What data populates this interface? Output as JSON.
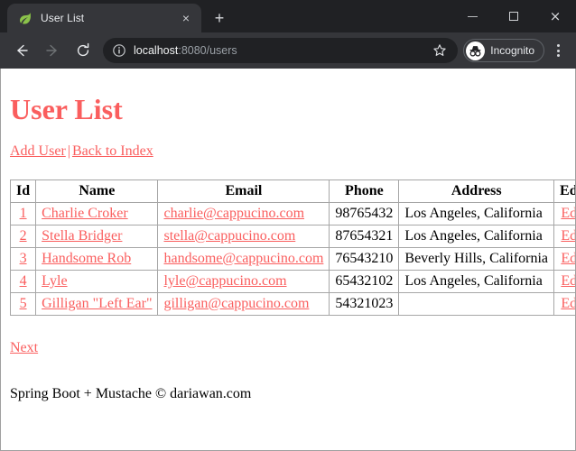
{
  "browser": {
    "tab": {
      "title": "User List",
      "favicon": "spring-leaf-icon",
      "close_label": "×"
    },
    "new_tab_label": "+",
    "window_controls": {
      "minimize": "−",
      "maximize": "□",
      "close": "×"
    },
    "toolbar": {
      "back_icon": "arrow-left-icon",
      "forward_icon": "arrow-right-icon",
      "reload_icon": "reload-icon",
      "site_info_icon": "info-circle-icon",
      "url_host": "localhost",
      "url_rest": ":8080/users",
      "bookmark_icon": "star-icon",
      "incognito_label": "Incognito",
      "incognito_icon": "incognito-hat-icon",
      "menu_icon": "three-dots-menu-icon"
    }
  },
  "page": {
    "title": "User List",
    "links": {
      "add_user": "Add User",
      "separator": "|",
      "back_to_index": "Back to Index"
    },
    "table": {
      "headers": [
        "Id",
        "Name",
        "Email",
        "Phone",
        "Address",
        "Edit"
      ],
      "rows": [
        {
          "id": "1",
          "name": "Charlie Croker",
          "email": "charlie@cappucino.com",
          "phone": "98765432",
          "address": "Los Angeles, California",
          "edit": "Edit"
        },
        {
          "id": "2",
          "name": "Stella Bridger",
          "email": "stella@cappucino.com",
          "phone": "87654321",
          "address": "Los Angeles, California",
          "edit": "Edit"
        },
        {
          "id": "3",
          "name": "Handsome Rob",
          "email": "handsome@cappucino.com",
          "phone": "76543210",
          "address": "Beverly Hills, California",
          "edit": "Edit"
        },
        {
          "id": "4",
          "name": "Lyle",
          "email": "lyle@cappucino.com",
          "phone": "65432102",
          "address": "Los Angeles, California",
          "edit": "Edit"
        },
        {
          "id": "5",
          "name": "Gilligan \"Left Ear\"",
          "email": "gilligan@cappucino.com",
          "phone": "54321023",
          "address": "",
          "edit": "Edit"
        }
      ]
    },
    "next_link": "Next",
    "footer": "Spring Boot + Mustache © dariawan.com"
  },
  "colors": {
    "link": "#fa5e5e",
    "heading": "#fa5e5e",
    "page_bg": "#ffffff",
    "chrome_dark": "#202124",
    "toolbar": "#35363a",
    "tab_active": "#35363a",
    "table_border": "#a6a6a6",
    "spring_green": "#8bc34a"
  }
}
